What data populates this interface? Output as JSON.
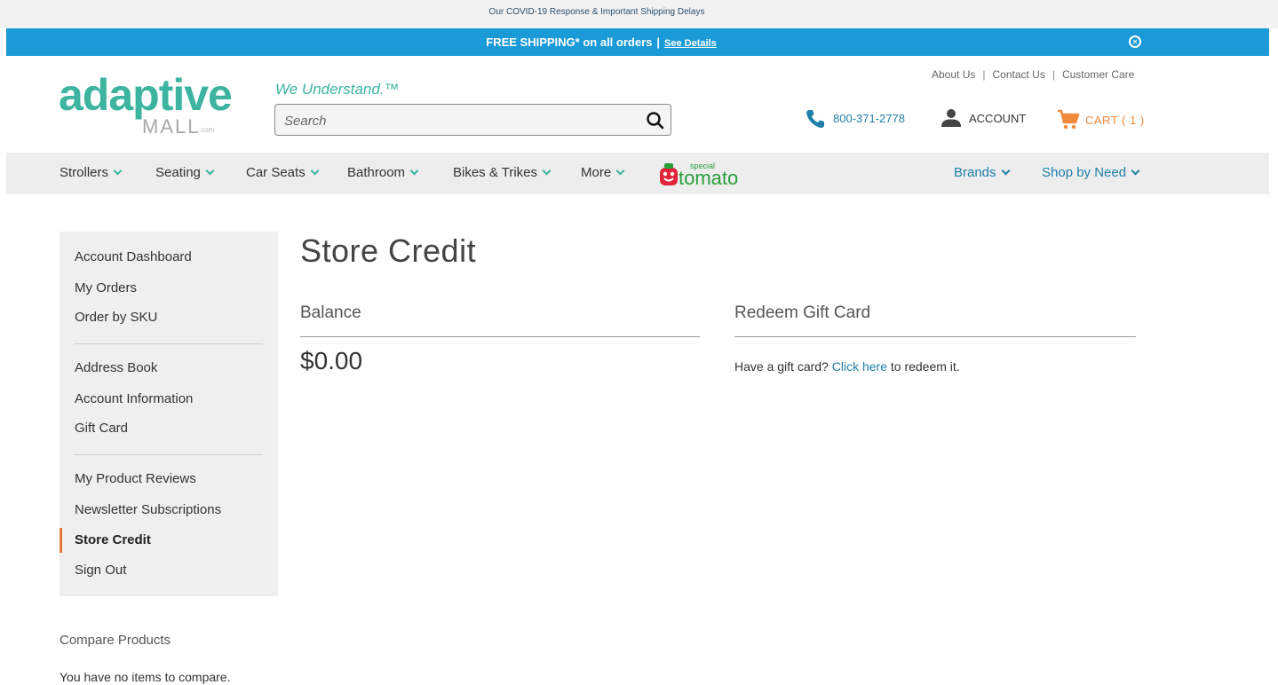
{
  "top_bar": {
    "covid_link": "Our COVID-19 Response & Important Shipping Delays"
  },
  "shipping_bar": {
    "text": "FREE SHIPPING* on all orders",
    "separator": "|",
    "details_link": "See Details",
    "background": "#1a9ad6"
  },
  "header": {
    "logo_main": "adaptive",
    "logo_sub": "MALL",
    "logo_com": ".com",
    "tagline": "We Understand.™",
    "search": {
      "placeholder": "Search",
      "value": ""
    },
    "util_links": [
      "About Us",
      "Contact Us",
      "Customer Care"
    ],
    "phone": "800-371-2778",
    "account_label": "ACCOUNT",
    "cart_label": "CART ( 1 )",
    "accent": "#3cb4a0",
    "cart_color": "#f08a3c"
  },
  "nav": {
    "items": [
      "Strollers",
      "Seating",
      "Car Seats",
      "Bathroom",
      "Bikes & Trikes",
      "More"
    ],
    "partner_logo_text_small": "special",
    "partner_logo_text": "tomato",
    "right_items": [
      "Brands",
      "Shop by Need"
    ]
  },
  "sidebar": {
    "group1": [
      "Account Dashboard",
      "My Orders",
      "Order by SKU"
    ],
    "group2": [
      "Address Book",
      "Account Information",
      "Gift Card"
    ],
    "group3": [
      "My Product Reviews",
      "Newsletter Subscriptions",
      "Store Credit",
      "Sign Out"
    ],
    "active": "Store Credit",
    "active_color": "#e5783a"
  },
  "main": {
    "title": "Store Credit",
    "balance_heading": "Balance",
    "balance_value": "$0.00",
    "redeem_heading": "Redeem Gift Card",
    "redeem_prefix": "Have a gift card?",
    "redeem_link": "Click here",
    "redeem_suffix": "to redeem it."
  },
  "compare": {
    "title": "Compare Products",
    "empty_text": "You have no items to compare."
  }
}
